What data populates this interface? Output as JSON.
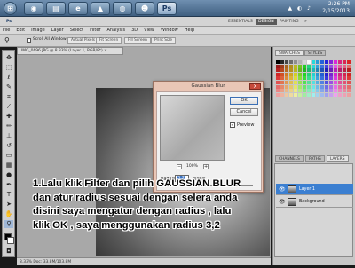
{
  "taskbar": {
    "apps": [
      "start-orb",
      "chrome",
      "file-explorer",
      "internet-explorer",
      "vlc",
      "firefox",
      "game-app",
      "photoshop"
    ],
    "tray_icons": "▲ ◐ ♪",
    "time": "2:26 PM",
    "date": "2/15/2013"
  },
  "photoshop": {
    "workspace_switcher": {
      "essentials": "ESSENTIALS",
      "design": "DESIGN",
      "painting": "PAINTING",
      "more": "»"
    },
    "menu": [
      "File",
      "Edit",
      "Image",
      "Layer",
      "Select",
      "Filter",
      "Analysis",
      "3D",
      "View",
      "Window",
      "Help"
    ],
    "options_bar": {
      "scroll_all_label": "Scroll All Windows",
      "btn1": "Actual Pixels",
      "btn2": "Fit Screen",
      "btn3": "Fill Screen",
      "btn4": "Print Size"
    },
    "document_tab": "IMG_0696.JPG @ 8.33% (Layer 1, RGB/8*) ×",
    "status_bar": "8.33%     Doc: 33.8M/103.8M",
    "panels": {
      "swatches_tab": "SWATCHES",
      "styles_tab": "STYLES",
      "channels_tab": "CHANNELS",
      "paths_tab": "PATHS",
      "layers_tab": "LAYERS",
      "blend_mode": "Normal"
    },
    "layers": [
      {
        "name": "Layer 1",
        "selected": true
      },
      {
        "name": "Background",
        "selected": false
      }
    ]
  },
  "dialog": {
    "title": "Gaussian Blur",
    "ok_label": "OK",
    "cancel_label": "Cancel",
    "preview_label": "Preview",
    "preview_checked": true,
    "zoom_value": "100%",
    "radius_label": "Radius:",
    "radius_value": "3.2",
    "radius_unit": "pixels",
    "close_glyph": "X"
  },
  "caption": {
    "line1": "1.Lalu klik Filter dan pilih GAUSSIAN BLUR",
    "line2": "dan atur radius sesuai dengan selera anda",
    "line3": "disini saya mengatur dengan radius  , lalu",
    "line4": "klik OK , saya menggunakan radius 3,2"
  },
  "colors": {
    "accent": "#3b7fd1",
    "dialog_frame": "#e9c6b6",
    "close_red": "#c64a3a"
  }
}
